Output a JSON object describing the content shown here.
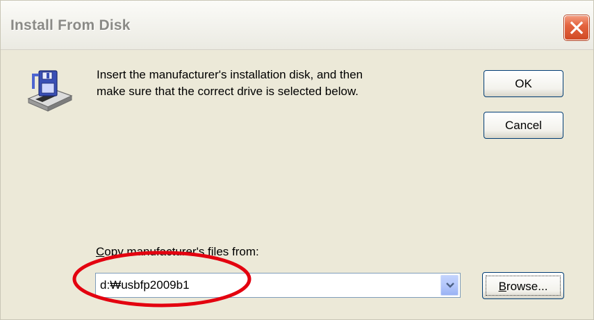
{
  "window": {
    "title": "Install From Disk",
    "close_icon": "close-x-icon"
  },
  "content": {
    "icon": "floppy-disk-drive-icon",
    "instruction_line1": "Insert the manufacturer's installation disk, and then",
    "instruction_line2": "make sure that the correct drive is selected below."
  },
  "buttons": {
    "ok_label": "OK",
    "cancel_label": "Cancel",
    "browse_label_underlined": "B",
    "browse_label_rest": "rowse..."
  },
  "copy_from": {
    "label_underlined": "C",
    "label_rest": "opy manufacturer's files from:",
    "value": "d:₩usbfp2009b1",
    "dropdown_icon": "chevron-down-icon"
  },
  "annotation": {
    "shape": "ellipse",
    "color": "#e3000f"
  },
  "colors": {
    "dialog_background": "#ece9d8",
    "close_button": "#d14b26",
    "button_border": "#003c74",
    "dropdown_button": "#b4c7fb"
  }
}
